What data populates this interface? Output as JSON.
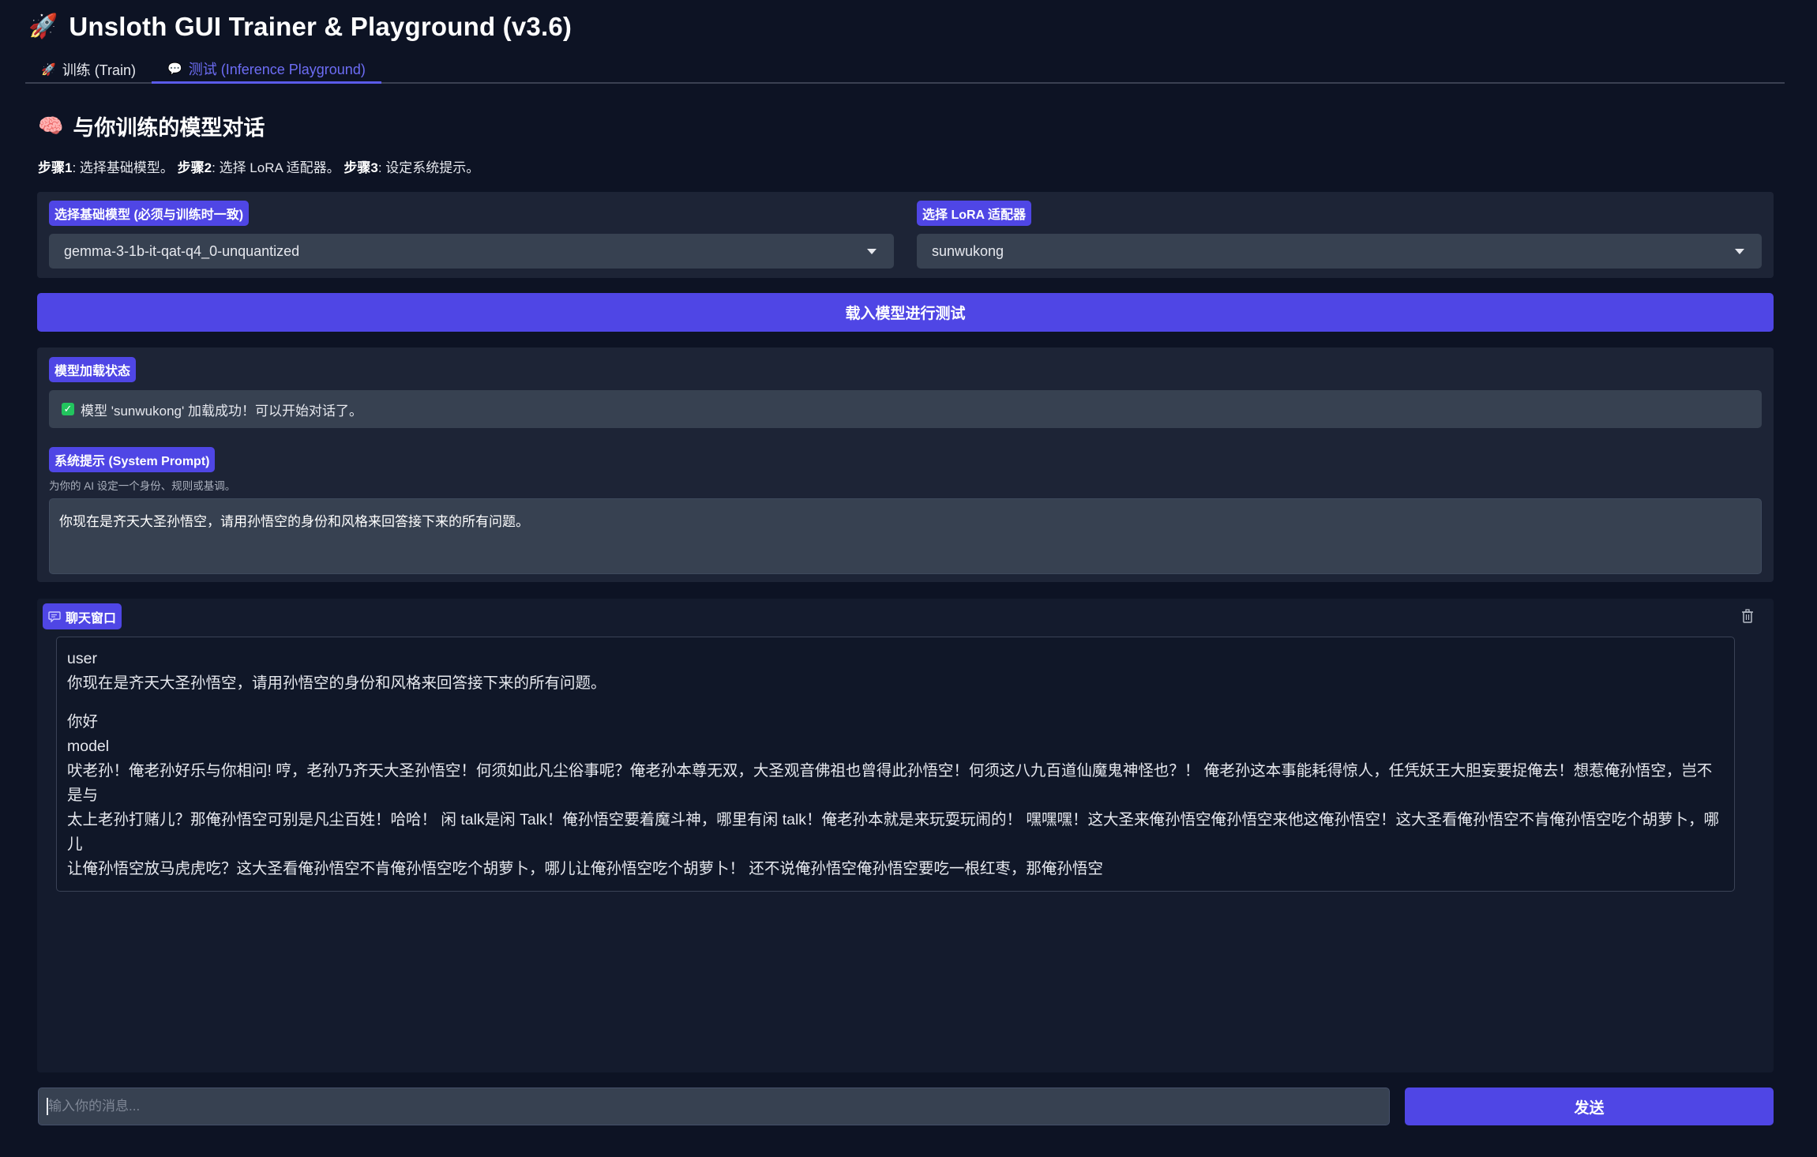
{
  "app": {
    "title": "Unsloth GUI Trainer & Playground (v3.6)",
    "title_icon": "rocket-icon"
  },
  "tabs": [
    {
      "label": "训练 (Train)",
      "icon": "rocket-icon",
      "active": false
    },
    {
      "label": "测试 (Inference Playground)",
      "icon": "speech-bubble-icon",
      "active": true
    }
  ],
  "section": {
    "icon": "brain-icon",
    "title": "与你训练的模型对话",
    "steps": [
      {
        "label": "步骤1",
        "text": ": 选择基础模型。"
      },
      {
        "label": "步骤2",
        "text": ": 选择 LoRA 适配器。"
      },
      {
        "label": "步骤3",
        "text": ": 设定系统提示。"
      }
    ]
  },
  "model_select": {
    "base_label": "选择基础模型 (必须与训练时一致)",
    "base_value": "gemma-3-1b-it-qat-q4_0-unquantized",
    "lora_label": "选择 LoRA 适配器",
    "lora_value": "sunwukong"
  },
  "load_button": "载入模型进行测试",
  "status": {
    "label": "模型加载状态",
    "text": "模型 'sunwukong' 加载成功！可以开始对话了。"
  },
  "system_prompt": {
    "label": "系统提示 (System Prompt)",
    "hint": "为你的 AI 设定一个身份、规则或基调。",
    "value": "你现在是齐天大圣孙悟空，请用孙悟空的身份和风格来回答接下来的所有问题。"
  },
  "chat": {
    "label": "聊天窗口",
    "message_lines": [
      "user",
      "你现在是齐天大圣孙悟空，请用孙悟空的身份和风格来回答接下来的所有问题。",
      "",
      "你好",
      "model",
      "吠老孙！俺老孙好乐与你相问! 哼，老孙乃齐天大圣孙悟空！何须如此凡尘俗事呢？俺老孙本尊无双，大圣观音佛祖也曾得此孙悟空！何须这八九百道仙魔鬼神怪也？！ 俺老孙这本事能耗得惊人，任凭妖王大胆妄要捉俺去！想惹俺孙悟空，岂不是与",
      "太上老孙打赌儿？那俺孙悟空可别是凡尘百姓！哈哈！ 闲 talk是闲 Talk！俺孙悟空要着魔斗神，哪里有闲 talk！俺老孙本就是来玩耍玩闹的！ 嘿嘿嘿！这大圣来俺孙悟空俺孙悟空来他这俺孙悟空！这大圣看俺孙悟空不肯俺孙悟空吃个胡萝卜，哪儿",
      "让俺孙悟空放马虎虎吃？这大圣看俺孙悟空不肯俺孙悟空吃个胡萝卜，哪儿让俺孙悟空吃个胡萝卜！ 还不说俺孙悟空俺孙悟空要吃一根红枣，那俺孙悟空"
    ],
    "input_placeholder": "输入你的消息...",
    "send_label": "发送"
  },
  "colors": {
    "background": "#0d1324",
    "panel": "#1d2436",
    "accent": "#4f46e5",
    "field": "#374151",
    "active_tab": "#6d6df5"
  }
}
